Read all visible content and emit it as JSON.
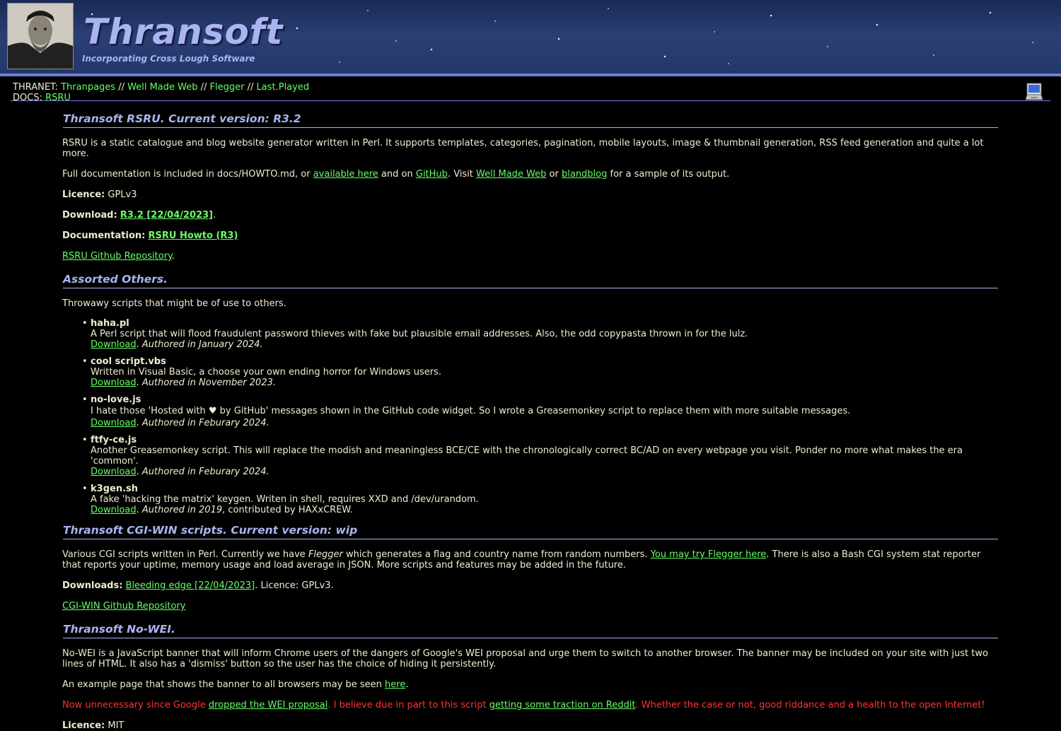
{
  "header": {
    "title": "Thransoft",
    "tagline": "Incorporating Cross Lough Software"
  },
  "nav": {
    "thranet_label": "THRANET:",
    "thranet_links": [
      "Thranpages",
      "Well Made Web",
      "Flegger",
      "Last.Played"
    ],
    "separator": "//",
    "docs_label": "DOCS:",
    "docs_link": "RSRU"
  },
  "rsru": {
    "heading": "Thransoft RSRU. Current version: R3.2",
    "intro": "RSRU is a static catalogue and blog website generator written in Perl. It supports templates, categories, pagination, mobile layouts, image & thumbnail generation, RSS feed generation and quite a lot more.",
    "doc_pre": "Full documentation is included in docs/HOWTO.md, or ",
    "doc_link1": "available here",
    "doc_mid1": " and on ",
    "doc_link2": "GitHub",
    "doc_mid2": ". Visit ",
    "doc_link3": "Well Made Web",
    "doc_mid3": " or ",
    "doc_link4": "blandblog",
    "doc_post": " for a sample of its output.",
    "licence_label": "Licence:",
    "licence_value": " GPLv3",
    "download_label": "Download:",
    "download_link": "R3.2 [22/04/2023]",
    "documentation_label": "Documentation:",
    "documentation_link": "RSRU Howto (R3)",
    "repo_link": "RSRU Github Repository"
  },
  "others": {
    "heading": "Assorted Others.",
    "intro": "Throwawy scripts that might be of use to others.",
    "items": [
      {
        "name": "haha.pl",
        "desc": "A Perl script that will flood fraudulent password thieves with fake but plausible email addresses. Also, the odd copypasta thrown in for the lulz.",
        "download": "Download",
        "authored": "Authored in January 2024.",
        "extra": ""
      },
      {
        "name": "cool script.vbs",
        "desc": "Written in Visual Basic, a choose your own ending horror for Windows users.",
        "download": "Download",
        "authored": "Authored in November 2023.",
        "extra": ""
      },
      {
        "name": "no-love.js",
        "desc": "I hate those 'Hosted with ♥ by GitHub' messages shown in the GitHub code widget. So I wrote a Greasemonkey script to replace them with more suitable messages.",
        "download": "Download",
        "authored": "Authored in Feburary 2024.",
        "extra": ""
      },
      {
        "name": "ftfy-ce.js",
        "desc": "Another Greasemonkey script. This will replace the modish and meaningless BCE/CE with the chronologically correct BC/AD on every webpage you visit. Ponder no more what makes the era 'common'.",
        "download": "Download",
        "authored": "Authored in Feburary 2024.",
        "extra": ""
      },
      {
        "name": "k3gen.sh",
        "desc": "A fake 'hacking the matrix' keygen. Writen in shell, requires XXD and /dev/urandom.",
        "download": "Download",
        "authored": "Authored in 2019",
        "extra": ", contributed by HAXxCREW."
      }
    ]
  },
  "cgi": {
    "heading": "Thransoft CGI-WIN scripts. Current version: wip",
    "p_pre": "Various CGI scripts written in Perl. Currently we have ",
    "p_em": "Flegger",
    "p_mid": " which generates a flag and country name from random numbers. ",
    "p_link": "You may try Flegger here",
    "p_post": ". There is also a Bash CGI system stat reporter that reports your uptime, memory usage and load average in JSON. More scripts and features may be added in the future.",
    "downloads_label": "Downloads:",
    "downloads_link": "Bleeding edge [22/04/2023]",
    "downloads_post": ". Licence: GPLv3.",
    "repo_link": "CGI-WIN Github Repository"
  },
  "nowei": {
    "heading": "Thransoft No-WEI.",
    "intro": "No-WEI is a JavaScript banner that will inform Chrome users of the dangers of Google's WEI proposal and urge them to switch to another browser. The banner may be included on your site with just two lines of HTML. It also has a 'dismiss' button so the user has the choice of hiding it persistently.",
    "example_pre": "An example page that shows the banner to all browsers may be seen ",
    "example_link": "here",
    "example_post": ".",
    "red_pre": "Now unnecessary since Google ",
    "red_link1": "dropped the WEI proposal",
    "red_mid": ". I believe due in part to this script ",
    "red_link2": "getting some traction on Reddit",
    "red_post": ". Whether the case or not, good riddance and a health to the open Internet!",
    "licence_label": "Licence:",
    "licence_value": " MIT"
  }
}
